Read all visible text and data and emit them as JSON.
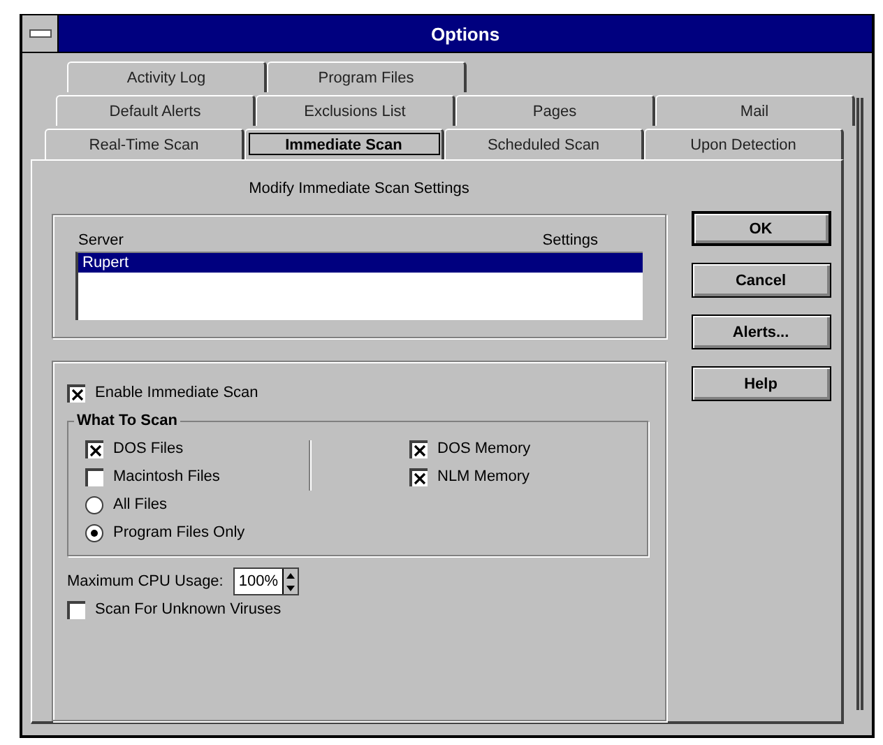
{
  "window": {
    "title": "Options"
  },
  "tab_rows": [
    [
      {
        "label": "Activity Log",
        "selected": false
      },
      {
        "label": "Program Files",
        "selected": false
      }
    ],
    [
      {
        "label": "Default Alerts",
        "selected": false
      },
      {
        "label": "Exclusions List",
        "selected": false
      },
      {
        "label": "Pages",
        "selected": false
      },
      {
        "label": "Mail",
        "selected": false
      }
    ],
    [
      {
        "label": "Real-Time Scan",
        "selected": false
      },
      {
        "label": "Immediate Scan",
        "selected": true
      },
      {
        "label": "Scheduled Scan",
        "selected": false
      },
      {
        "label": "Upon Detection",
        "selected": false
      }
    ]
  ],
  "heading": "Modify Immediate Scan Settings",
  "server_list": {
    "columns": [
      "Server",
      "Settings"
    ],
    "rows": [
      {
        "server": "Rupert",
        "selected": true
      }
    ]
  },
  "enable": {
    "label": "Enable Immediate Scan",
    "checked": true
  },
  "what_to_scan": {
    "title": "What To Scan",
    "left": [
      {
        "kind": "checkbox",
        "label": "DOS Files",
        "checked": true
      },
      {
        "kind": "checkbox",
        "label": "Macintosh Files",
        "checked": false
      },
      {
        "kind": "radio",
        "label": "All Files",
        "selected": false
      },
      {
        "kind": "radio",
        "label": "Program Files Only",
        "selected": true
      }
    ],
    "right": [
      {
        "kind": "checkbox",
        "label": "DOS Memory",
        "checked": true
      },
      {
        "kind": "checkbox",
        "label": "NLM Memory",
        "checked": true
      }
    ]
  },
  "cpu": {
    "label": "Maximum CPU Usage:",
    "value": "100%"
  },
  "unknown": {
    "label": "Scan For Unknown Viruses",
    "checked": false
  },
  "buttons": [
    {
      "label": "OK",
      "default": true
    },
    {
      "label": "Cancel",
      "default": false
    },
    {
      "label": "Alerts...",
      "default": false
    },
    {
      "label": "Help",
      "default": false
    }
  ]
}
